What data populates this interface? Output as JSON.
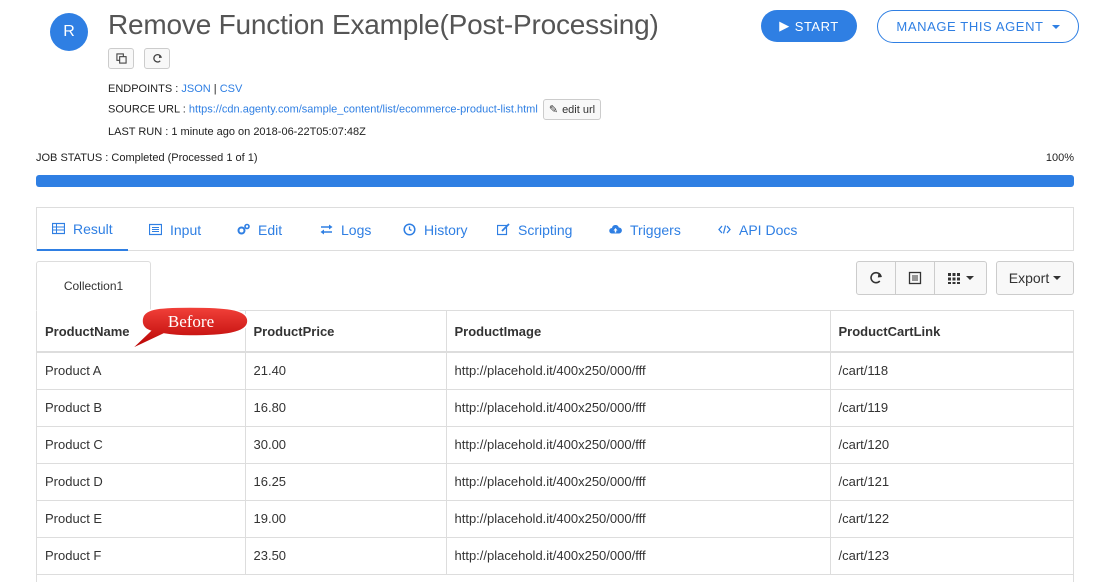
{
  "header": {
    "avatar_letter": "R",
    "title": "Remove Function Example(Post-Processing)",
    "start_label": "START",
    "manage_label": "MANAGE THIS AGENT"
  },
  "meta": {
    "endpoints_label": "ENDPOINTS :",
    "endpoint_json": "JSON",
    "endpoint_sep": "|",
    "endpoint_csv": "CSV",
    "source_label": "SOURCE URL :",
    "source_url": "https://cdn.agenty.com/sample_content/list/ecommerce-product-list.html",
    "edit_url_label": "edit url",
    "last_run": "LAST RUN : 1 minute ago on 2018-06-22T05:07:48Z"
  },
  "job": {
    "status": "JOB STATUS : Completed (Processed 1 of 1)",
    "percent_label": "100%",
    "progress": 1.0
  },
  "tabs": [
    {
      "label": "Result",
      "icon": "table-icon"
    },
    {
      "label": "Input",
      "icon": "list-icon"
    },
    {
      "label": "Edit",
      "icon": "gears-icon"
    },
    {
      "label": "Logs",
      "icon": "exchange-icon"
    },
    {
      "label": "History",
      "icon": "clock-icon"
    },
    {
      "label": "Scripting",
      "icon": "edit-icon"
    },
    {
      "label": "Triggers",
      "icon": "cloud-upload-icon"
    },
    {
      "label": "API Docs",
      "icon": "code-icon"
    }
  ],
  "collection_tab": "Collection1",
  "export_label": "Export",
  "annotation": "Before",
  "table": {
    "columns": [
      "ProductName",
      "ProductPrice",
      "ProductImage",
      "ProductCartLink"
    ],
    "rows": [
      [
        "Product A",
        "21.40",
        "http://placehold.it/400x250/000/fff",
        "/cart/118"
      ],
      [
        "Product B",
        "16.80",
        "http://placehold.it/400x250/000/fff",
        "/cart/119"
      ],
      [
        "Product C",
        "30.00",
        "http://placehold.it/400x250/000/fff",
        "/cart/120"
      ],
      [
        "Product D",
        "16.25",
        "http://placehold.it/400x250/000/fff",
        "/cart/121"
      ],
      [
        "Product E",
        "19.00",
        "http://placehold.it/400x250/000/fff",
        "/cart/122"
      ],
      [
        "Product F",
        "23.50",
        "http://placehold.it/400x250/000/fff",
        "/cart/123"
      ]
    ]
  },
  "colors": {
    "accent": "#2f7fe3",
    "annotation_red": "#d0021b"
  }
}
